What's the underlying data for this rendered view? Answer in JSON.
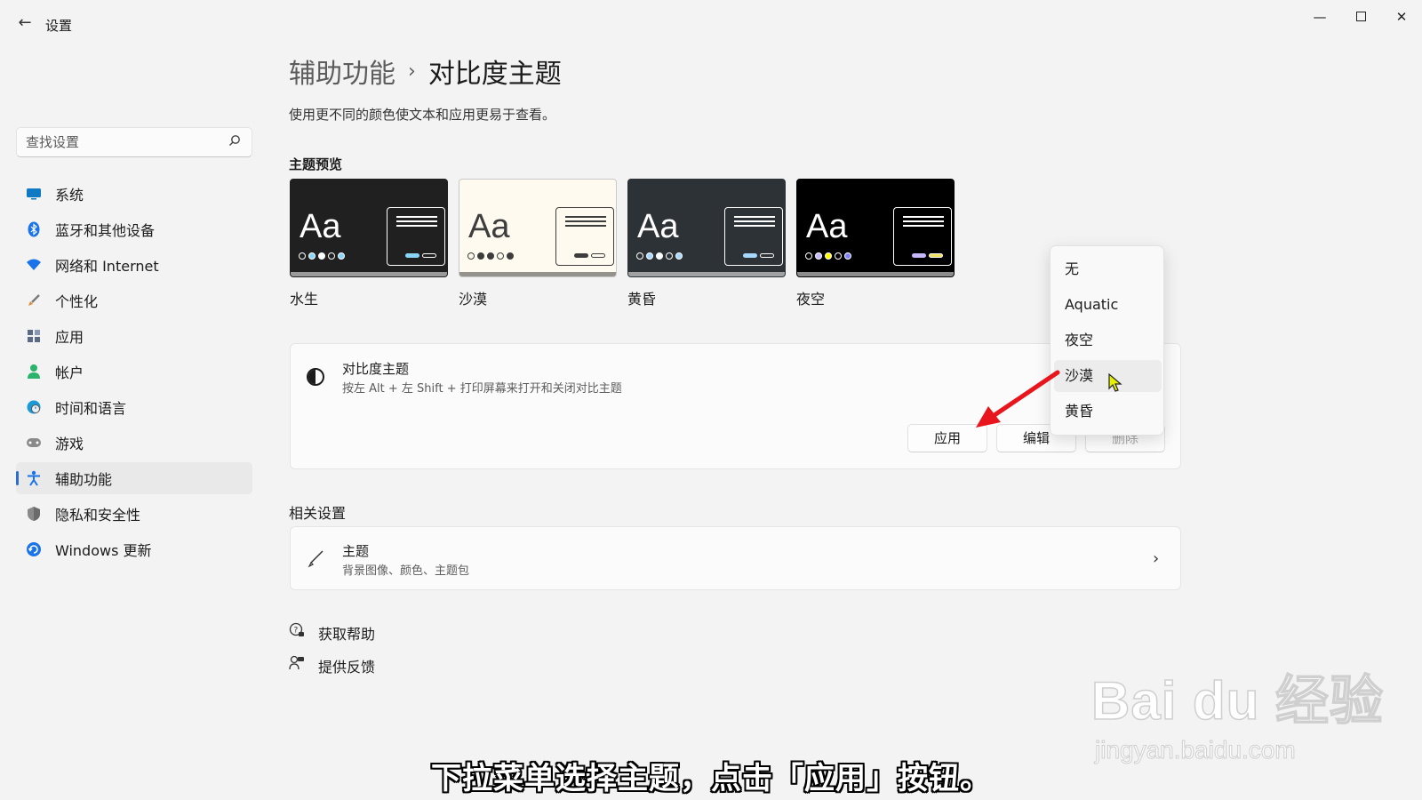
{
  "window": {
    "title": "设置",
    "back_glyph": "←",
    "minimize_glyph": "—",
    "close_glyph": "✕"
  },
  "search": {
    "placeholder": "查找设置",
    "icon": "search-icon"
  },
  "sidebar": {
    "items": [
      {
        "label": "系统",
        "icon": "monitor-icon",
        "color": "#0e7ac4"
      },
      {
        "label": "蓝牙和其他设备",
        "icon": "bluetooth-icon",
        "color": "#1a73e8"
      },
      {
        "label": "网络和 Internet",
        "icon": "wifi-icon",
        "color": "#1a73e8"
      },
      {
        "label": "个性化",
        "icon": "brush-icon",
        "color": "#e08a2c"
      },
      {
        "label": "应用",
        "icon": "apps-icon",
        "color": "#5b6b86"
      },
      {
        "label": "帐户",
        "icon": "account-icon",
        "color": "#2cb36b"
      },
      {
        "label": "时间和语言",
        "icon": "globe-clock-icon",
        "color": "#1a9ad6"
      },
      {
        "label": "游戏",
        "icon": "gamepad-icon",
        "color": "#6b6b6b"
      },
      {
        "label": "辅助功能",
        "icon": "accessibility-icon",
        "color": "#1a73e8",
        "active": true
      },
      {
        "label": "隐私和安全性",
        "icon": "shield-icon",
        "color": "#6b6b6b"
      },
      {
        "label": "Windows 更新",
        "icon": "update-icon",
        "color": "#1a73e8"
      }
    ]
  },
  "header": {
    "breadcrumb_parent": "辅助功能",
    "breadcrumb_sep": "›",
    "breadcrumb_current": "对比度主题",
    "subtitle": "使用更不同的颜色使文本和应用更易于查看。"
  },
  "preview": {
    "title": "主题预览",
    "sample_text": "Aa",
    "themes": [
      {
        "name": "水生",
        "bg": "#202020",
        "fg": "#ffffff",
        "win_bg": "#202020",
        "win_border": "#ffffff",
        "dots": [
          "#202020",
          "#8ad5f5",
          "#ffffff",
          "#202020",
          "#8ad5f5"
        ],
        "pills": [
          "#8ad5f5",
          "#202020"
        ]
      },
      {
        "name": "沙漠",
        "bg": "#fffaef",
        "fg": "#3d3d3d",
        "win_bg": "#fffaef",
        "win_border": "#3d3d3d",
        "dots": [
          "#fffaef",
          "#3d3d3d",
          "#3d3d3d",
          "#fffaef",
          "#3d3d3d"
        ],
        "pills": [
          "#3d3d3d",
          "#fffaef"
        ]
      },
      {
        "name": "黄昏",
        "bg": "#2d3236",
        "fg": "#ffffff",
        "win_bg": "#2d3236",
        "win_border": "#ffffff",
        "dots": [
          "#2d3236",
          "#a6d8ff",
          "#ffffff",
          "#2d3236",
          "#a6d8ff"
        ],
        "pills": [
          "#a6d8ff",
          "#2d3236"
        ]
      },
      {
        "name": "夜空",
        "bg": "#000000",
        "fg": "#ffffff",
        "win_bg": "#000000",
        "win_border": "#ffffff",
        "dots": [
          "#000000",
          "#c7b7ff",
          "#ffff00",
          "#000000",
          "#8080ff"
        ],
        "pills": [
          "#c7b7ff",
          "#f0e060"
        ]
      }
    ]
  },
  "contrast_panel": {
    "title": "对比度主题",
    "desc": "按左 Alt + 左 Shift + 打印屏幕来打开和关闭对比主题",
    "apply_label": "应用",
    "edit_label": "编辑",
    "delete_label": "删除"
  },
  "dropdown": {
    "options": [
      "无",
      "Aquatic",
      "夜空",
      "沙漠",
      "黄昏"
    ],
    "selected": "沙漠"
  },
  "related": {
    "title": "相关设置",
    "theme_title": "主题",
    "theme_desc": "背景图像、颜色、主题包",
    "chevron": "›"
  },
  "links": {
    "help": "获取帮助",
    "feedback": "提供反馈"
  },
  "watermark": {
    "main": "Bai du 经验",
    "sub": "jingyan.baidu.com"
  },
  "caption": "下拉菜单选择主题，点击「应用」按钮。",
  "annotation_color": "#e8161c"
}
